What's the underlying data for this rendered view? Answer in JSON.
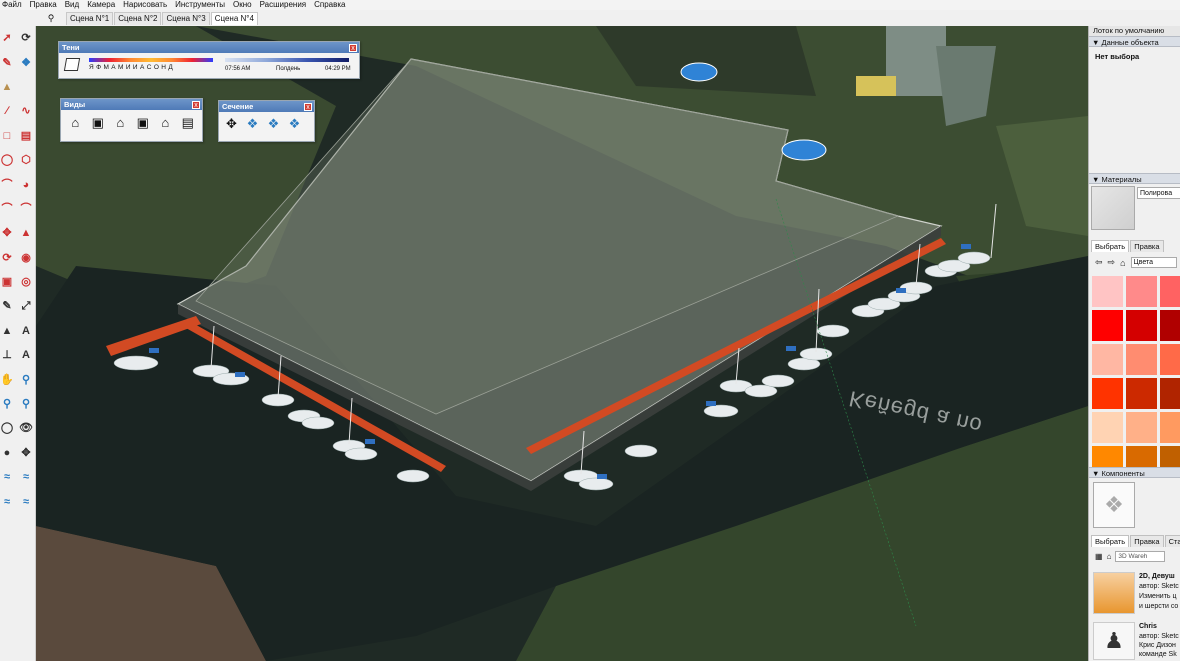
{
  "menu": [
    "Файл",
    "Правка",
    "Вид",
    "Камера",
    "Нарисовать",
    "Инструменты",
    "Окно",
    "Расширения",
    "Справка"
  ],
  "scene_tabs": [
    "Сцена N°1",
    "Сцена N°2",
    "Сцена N°3",
    "Сцена N°4"
  ],
  "active_scene_index": 3,
  "shadows_panel": {
    "title": "Тени",
    "months": "Я Ф М А М И И А С О Н Д",
    "time_start": "07:56 AM",
    "time_mid": "Полдень",
    "time_end": "04:29 PM"
  },
  "views_panel": {
    "title": "Виды"
  },
  "section_panel": {
    "title": "Сечение"
  },
  "tray": {
    "title": "Лоток по умолчанию",
    "entity_info": {
      "title": "Данные объекта",
      "value": "Нет выбора"
    },
    "materials": {
      "title": "Материалы",
      "material_name": "Полирова",
      "tab_select": "Выбрать",
      "tab_edit": "Правка",
      "collection": "Цвета",
      "colors": [
        "#ffc4c4",
        "#ff8a8a",
        "#ff6262",
        "#ff0000",
        "#d40000",
        "#b00000",
        "#ffb7a3",
        "#ff8c70",
        "#ff6a48",
        "#ff3300",
        "#cc2900",
        "#b02400",
        "#ffd3b3",
        "#ffb088",
        "#ff9a60",
        "#ff8800",
        "#d96a00",
        "#c06000"
      ]
    },
    "components": {
      "title": "Компоненты",
      "tab_select": "Выбрать",
      "tab_edit": "Правка",
      "tab_stats": "Стат",
      "search_placeholder": "3D Wareh",
      "items": [
        {
          "name": "2D, Девуш",
          "line1": "автор: Sketc",
          "line2": "Изменить ц",
          "line3": "и шерсти со"
        },
        {
          "name": "Chris",
          "line1": "автор: Sketc",
          "line2": "Крис Дизон",
          "line3": "команде Sk"
        }
      ]
    }
  },
  "viewport_labels": {
    "water_label": "Keñegd a no"
  }
}
